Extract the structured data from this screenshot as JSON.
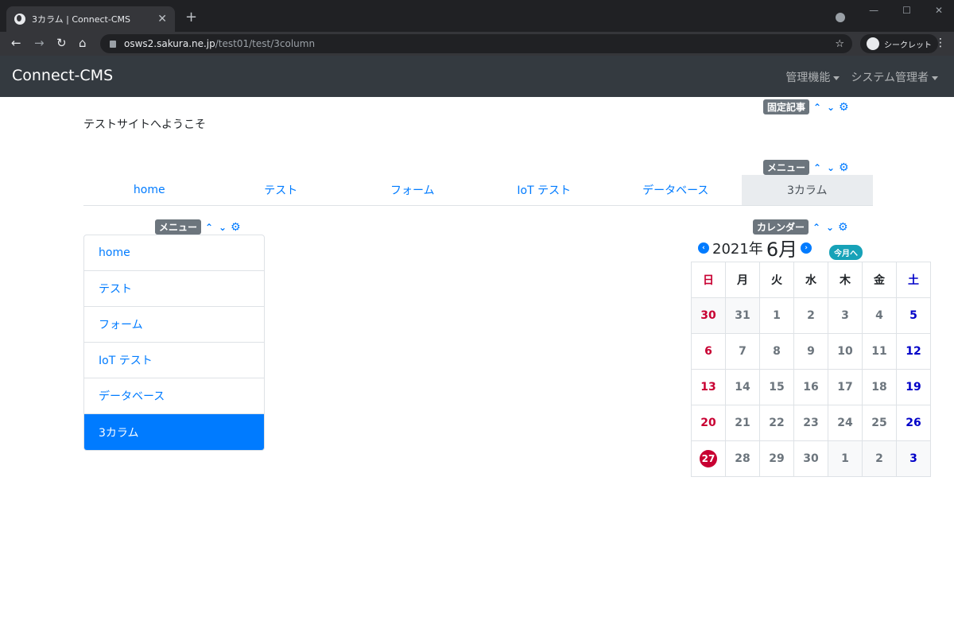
{
  "browser": {
    "tab_title": "3カラム | Connect-CMS",
    "new_tab": "+",
    "url_host": "osws2.sakura.ne.jp",
    "url_path": "/test01/test/3column",
    "incognito_label": "シークレット",
    "win_minimize": "—",
    "win_maximize": "☐",
    "win_close": "✕"
  },
  "app": {
    "brand": "Connect-CMS",
    "nav": [
      "管理機能",
      "システム管理者"
    ]
  },
  "frames": {
    "fixed_article": "固定記事",
    "menu_top": "メニュー",
    "menu_side": "メニュー",
    "calendar": "カレンダー"
  },
  "welcome_text": "テストサイトへようこそ",
  "top_nav": {
    "items": [
      "home",
      "テスト",
      "フォーム",
      "IoT テスト",
      "データベース",
      "3カラム"
    ],
    "active_index": 5
  },
  "side_menu": {
    "items": [
      "home",
      "テスト",
      "フォーム",
      "IoT テスト",
      "データベース",
      "3カラム"
    ],
    "active_index": 5
  },
  "calendar": {
    "year": "2021年",
    "month": "6月",
    "today_button": "今月へ",
    "weekdays": [
      "日",
      "月",
      "火",
      "水",
      "木",
      "金",
      "土"
    ],
    "weeks": [
      [
        "30",
        "31",
        "1",
        "2",
        "3",
        "4",
        "5"
      ],
      [
        "6",
        "7",
        "8",
        "9",
        "10",
        "11",
        "12"
      ],
      [
        "13",
        "14",
        "15",
        "16",
        "17",
        "18",
        "19"
      ],
      [
        "20",
        "21",
        "22",
        "23",
        "24",
        "25",
        "26"
      ],
      [
        "27",
        "28",
        "29",
        "30",
        "1",
        "2",
        "3"
      ]
    ],
    "today": "27"
  },
  "colors": {
    "primary": "#007bff",
    "sunday": "#c80032",
    "saturday": "#0000c8",
    "navbar": "#343a40"
  }
}
